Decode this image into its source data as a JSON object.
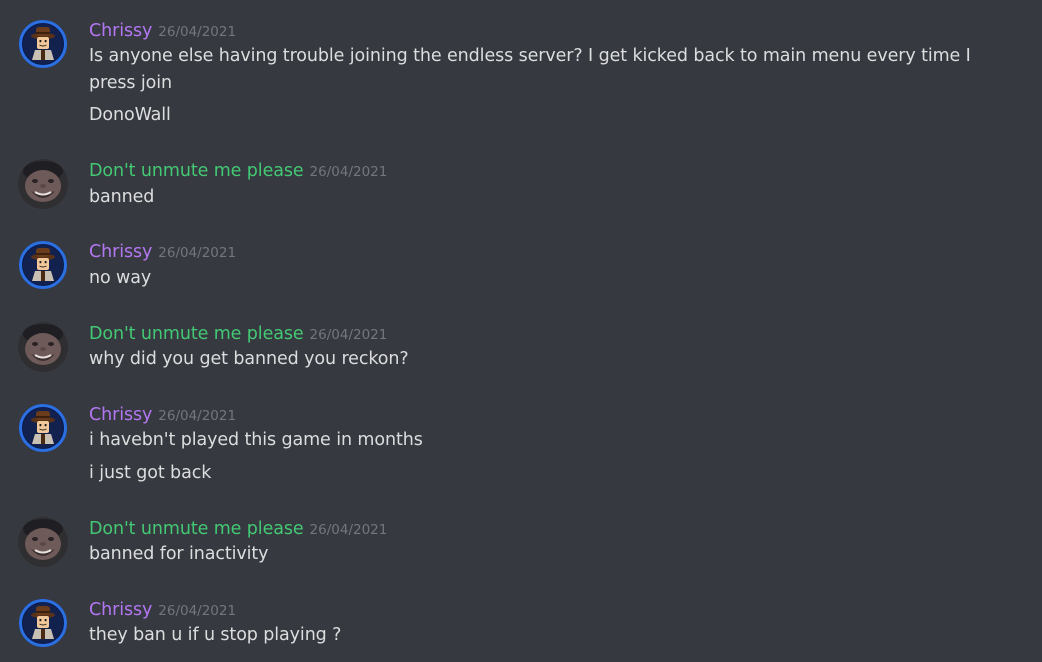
{
  "colors": {
    "background": "#36393f",
    "chrissy": "#b377f3",
    "dont_unmute": "#43c974",
    "text": "#dcddde",
    "timestamp": "#72767d"
  },
  "messages": [
    {
      "author": "Chrissy",
      "timestamp": "26/04/2021",
      "lines": [
        "Is anyone else having trouble joining the endless server? I get kicked back to main menu every time I press join",
        "DonoWall"
      ]
    },
    {
      "author": "Don't unmute me please",
      "timestamp": "26/04/2021",
      "lines": [
        "banned"
      ]
    },
    {
      "author": "Chrissy",
      "timestamp": "26/04/2021",
      "lines": [
        "no way"
      ]
    },
    {
      "author": "Don't unmute me please",
      "timestamp": "26/04/2021",
      "lines": [
        "why did you get banned you reckon?"
      ]
    },
    {
      "author": "Chrissy",
      "timestamp": "26/04/2021",
      "lines": [
        "i havebn't played this game in months",
        "i just got back"
      ]
    },
    {
      "author": "Don't unmute me please",
      "timestamp": "26/04/2021",
      "lines": [
        "banned for inactivity"
      ]
    },
    {
      "author": "Chrissy",
      "timestamp": "26/04/2021",
      "lines": [
        "they ban u if u stop playing ?"
      ]
    }
  ]
}
